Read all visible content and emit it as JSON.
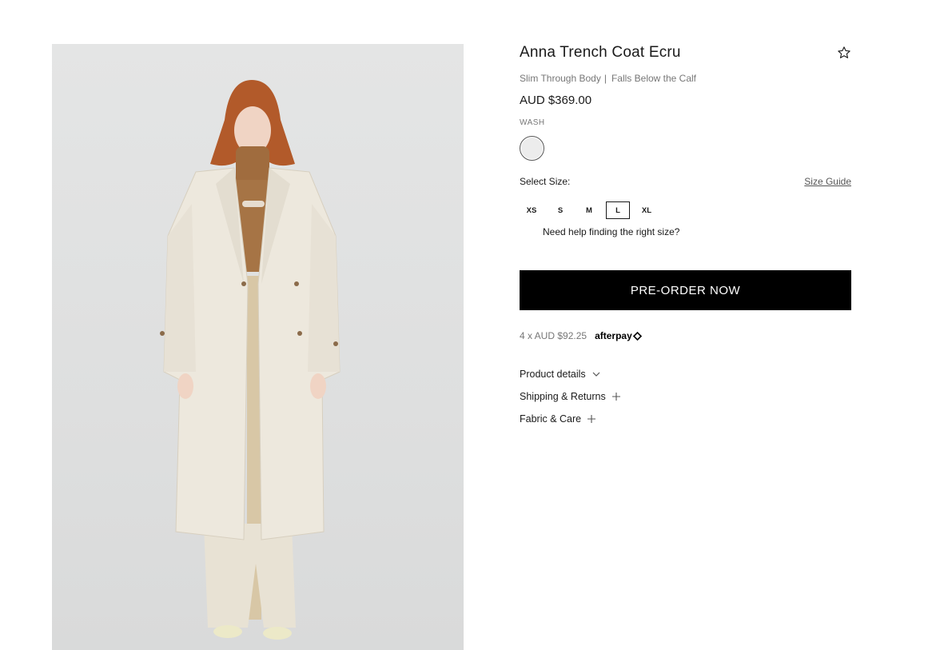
{
  "product": {
    "title": "Anna Trench Coat Ecru",
    "fit_1": "Slim Through Body",
    "fit_2": "Falls Below the Calf",
    "price": "AUD $369.00",
    "wash_label": "WASH",
    "select_size_label": "Select Size:",
    "size_guide_label": "Size Guide",
    "sizes": [
      "XS",
      "S",
      "M",
      "L",
      "XL"
    ],
    "selected_size": "L",
    "help_text": "Need help finding the right size?",
    "cta_label": "PRE-ORDER NOW",
    "installment_text": "4 x AUD $92.25",
    "afterpay_label": "afterpay"
  },
  "accordion": [
    {
      "label": "Product details",
      "icon": "chevron-down-icon"
    },
    {
      "label": "Shipping & Returns",
      "icon": "plus-icon"
    },
    {
      "label": "Fabric & Care",
      "icon": "plus-icon"
    }
  ],
  "colors": {
    "swatch": "#ececec",
    "cta_bg": "#000000",
    "image_bg": "#dedfdf"
  }
}
